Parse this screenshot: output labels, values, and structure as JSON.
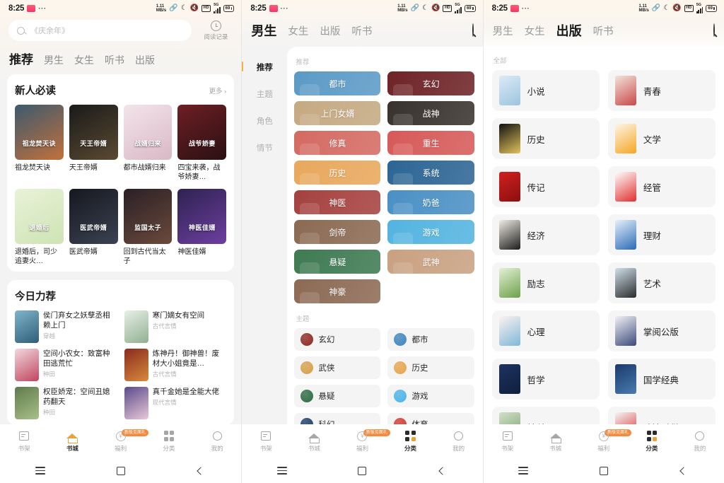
{
  "status_bar": {
    "time": "8:25",
    "dots": "···",
    "net_speed_value": "1.11",
    "net_speed_unit": "MB/s",
    "hd_label": "HD",
    "net_type": "5G",
    "battery": "69"
  },
  "screen1": {
    "search": {
      "placeholder": "《庆余年》"
    },
    "history_label": "阅读记录",
    "tabs": [
      {
        "label": "推荐",
        "active": true
      },
      {
        "label": "男生",
        "active": false
      },
      {
        "label": "女生",
        "active": false
      },
      {
        "label": "听书",
        "active": false
      },
      {
        "label": "出版",
        "active": false
      }
    ],
    "section1": {
      "title": "新人必读",
      "more": "更多 ›",
      "books": [
        {
          "name": "祖龙焚天诀",
          "c1": "#3c5a6e",
          "c2": "#c2703c",
          "cover_title": "祖龙焚天诀"
        },
        {
          "name": "天王帝婿",
          "c1": "#1a1a1a",
          "c2": "#5a4a32",
          "cover_title": "天王帝婿"
        },
        {
          "name": "都市战婿归来",
          "c1": "#f3e4ea",
          "c2": "#d9b8c6",
          "cover_title": "战婿归来"
        },
        {
          "name": "四宝来袭，战爷娇妻…",
          "c1": "#6d1f24",
          "c2": "#2b1013",
          "cover_title": "战爷娇妻"
        },
        {
          "name": "退婚后，司少追妻火…",
          "c1": "#e8f2d8",
          "c2": "#cfe3b4",
          "cover_title": "退婚后"
        },
        {
          "name": "医武帝婿",
          "c1": "#16181f",
          "c2": "#3c4252",
          "cover_title": "医武帝婿"
        },
        {
          "name": "回到古代当太子",
          "c1": "#2a2026",
          "c2": "#6b4a3c",
          "cover_title": "监国太子"
        },
        {
          "name": "神医佳婿",
          "c1": "#2e2250",
          "c2": "#6d3fa0",
          "cover_title": "神医佳婿"
        }
      ]
    },
    "section2": {
      "title": "今日力荐",
      "books": [
        {
          "title": "侯门弃女之妖孽丞相赖上门",
          "tag": "穿越",
          "c1": "#7fb6c9",
          "c2": "#2e5d7a"
        },
        {
          "title": "寒门嫡女有空间",
          "tag": "古代言情",
          "c1": "#e8efe6",
          "c2": "#8fb091"
        },
        {
          "title": "空间小农女：致富种田逃荒忙",
          "tag": "种田",
          "c1": "#f2d8df",
          "c2": "#c0455e"
        },
        {
          "title": "炼神丹！御神兽！废材大小姐竟是…",
          "tag": "古代言情",
          "c1": "#8a2a1e",
          "c2": "#d88a3c"
        },
        {
          "title": "权臣娇宠：空间丑媳药翻天",
          "tag": "种田",
          "c1": "#5f7a4a",
          "c2": "#a8c08a"
        },
        {
          "title": "真千金她是全能大佬",
          "tag": "现代言情",
          "c1": "#5a4a8a",
          "c2": "#e9c8d8"
        }
      ]
    }
  },
  "screen2": {
    "tabs": [
      {
        "label": "男生",
        "active": true
      },
      {
        "label": "女生",
        "active": false
      },
      {
        "label": "出版",
        "active": false
      },
      {
        "label": "听书",
        "active": false
      }
    ],
    "search_icon": "search-icon",
    "sidebar": [
      {
        "label": "推荐",
        "active": true
      },
      {
        "label": "主题",
        "active": false
      },
      {
        "label": "角色",
        "active": false
      },
      {
        "label": "情节",
        "active": false
      }
    ],
    "group1_label": "推荐",
    "tiles": [
      {
        "label": "都市",
        "color": "#5b9ac6"
      },
      {
        "label": "玄幻",
        "color": "#6e2327"
      },
      {
        "label": "上门女婿",
        "color": "#c5a982"
      },
      {
        "label": "战神",
        "color": "#38322d"
      },
      {
        "label": "修真",
        "color": "#d46a62"
      },
      {
        "label": "重生",
        "color": "#d65a58"
      },
      {
        "label": "历史",
        "color": "#e8a85c"
      },
      {
        "label": "系统",
        "color": "#2c6594"
      },
      {
        "label": "神医",
        "color": "#a5413f"
      },
      {
        "label": "奶爸",
        "color": "#4a90c4"
      },
      {
        "label": "剑帝",
        "color": "#8b6a52"
      },
      {
        "label": "游戏",
        "color": "#53b4e0"
      },
      {
        "label": "悬疑",
        "color": "#3e7a52"
      },
      {
        "label": "武神",
        "color": "#c9a181"
      },
      {
        "label": "神豪",
        "color": "#8d6a54"
      }
    ],
    "group2_label": "主题",
    "themes": [
      {
        "label": "玄幻",
        "color": "#8e2b25"
      },
      {
        "label": "都市",
        "color": "#3f86bd"
      },
      {
        "label": "武侠",
        "color": "#d6a14a"
      },
      {
        "label": "历史",
        "color": "#e8a44e"
      },
      {
        "label": "悬疑",
        "color": "#2f6b45"
      },
      {
        "label": "游戏",
        "color": "#4db4e8"
      },
      {
        "label": "科幻",
        "color": "#1f3f6b"
      },
      {
        "label": "体育",
        "color": "#d23b33"
      }
    ]
  },
  "screen3": {
    "tabs": [
      {
        "label": "男生",
        "active": false
      },
      {
        "label": "女生",
        "active": false
      },
      {
        "label": "出版",
        "active": true
      },
      {
        "label": "听书",
        "active": false
      }
    ],
    "all_label": "全部",
    "categories": [
      {
        "label": "小说",
        "c1": "#dceaf5",
        "c2": "#9cc4e0"
      },
      {
        "label": "青春",
        "c1": "#f2e4da",
        "c2": "#c8484a"
      },
      {
        "label": "历史",
        "c1": "#121212",
        "c2": "#e0c25a"
      },
      {
        "label": "文学",
        "c1": "#fdf6e8",
        "c2": "#f5a623"
      },
      {
        "label": "传记",
        "c1": "#d21f1f",
        "c2": "#8a1010"
      },
      {
        "label": "经管",
        "c1": "#ffffff",
        "c2": "#e03030"
      },
      {
        "label": "经济",
        "c1": "#f0ece4",
        "c2": "#1c1c1c"
      },
      {
        "label": "理财",
        "c1": "#e6f0fa",
        "c2": "#2a6bb5"
      },
      {
        "label": "励志",
        "c1": "#e4f0d8",
        "c2": "#6ea04a"
      },
      {
        "label": "艺术",
        "c1": "#cfe0ea",
        "c2": "#2b2b2b"
      },
      {
        "label": "心理",
        "c1": "#fdf2f0",
        "c2": "#7fb8d8"
      },
      {
        "label": "掌阅公版",
        "c1": "#f4f2f6",
        "c2": "#3a4a7a"
      },
      {
        "label": "哲学",
        "c1": "#1d3461",
        "c2": "#0f1f3d"
      },
      {
        "label": "国学经典",
        "c1": "#1a3a6b",
        "c2": "#4a7ab0"
      },
      {
        "label": "社科",
        "c1": "#cfe0c8",
        "c2": "#7a9e6a"
      },
      {
        "label": "政法财税",
        "c1": "#f5f5f5",
        "c2": "#d42020"
      }
    ]
  },
  "bottom_nav": {
    "items": [
      {
        "label": "书架",
        "icon": "bookshelf-icon"
      },
      {
        "label": "书城",
        "icon": "home-icon"
      },
      {
        "label": "福利",
        "icon": "coin-icon",
        "badge": "新版见面礼"
      },
      {
        "label": "分类",
        "icon": "grid-icon"
      },
      {
        "label": "我的",
        "icon": "profile-icon"
      }
    ],
    "active_screen1": "书城",
    "active_screen2": "分类",
    "active_screen3": "分类"
  },
  "system_bar": {
    "menu": "menu-icon",
    "home": "square-home-icon",
    "back": "back-chevron-icon"
  }
}
